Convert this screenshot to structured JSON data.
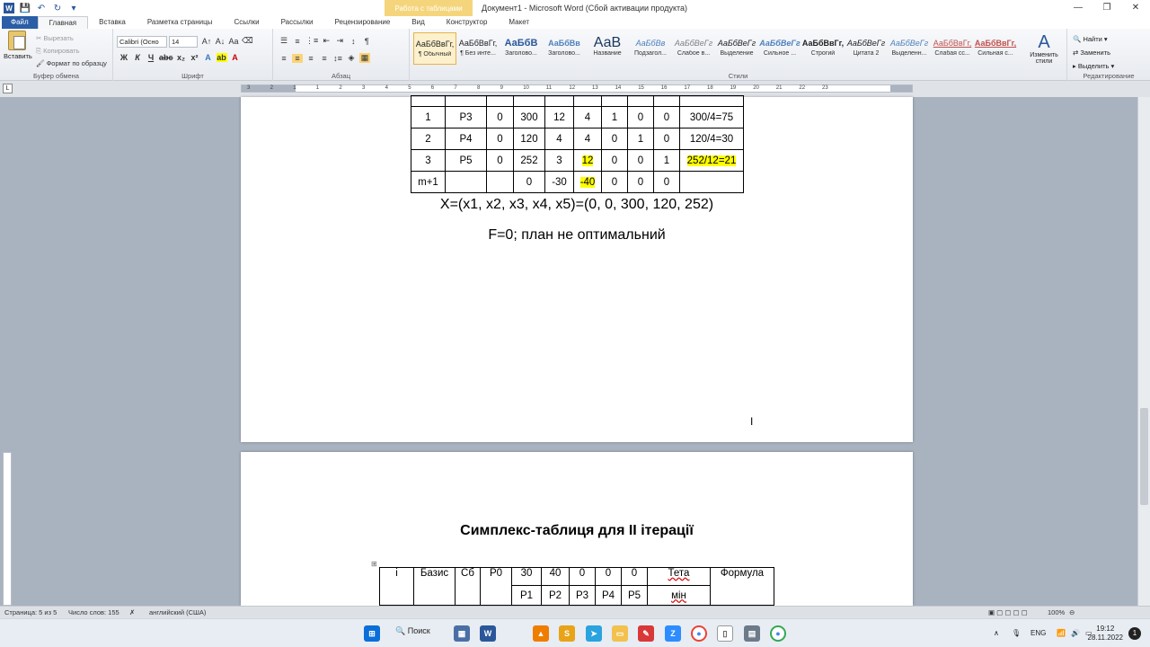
{
  "window": {
    "context_tab": "Работа с таблицами",
    "title": "Документ1 - Microsoft Word (Сбой активации продукта)",
    "minimize": "—",
    "maximize": "❐",
    "close": "✕"
  },
  "tabs": [
    "Файл",
    "Главная",
    "Вставка",
    "Разметка страницы",
    "Ссылки",
    "Рассылки",
    "Рецензирование",
    "Вид",
    "Конструктор",
    "Макет"
  ],
  "ribbon": {
    "clipboard": {
      "label": "Буфер обмена",
      "paste": "Вставить",
      "cut": "Вырезать",
      "copy": "Копировать",
      "format_painter": "Формат по образцу"
    },
    "font": {
      "label": "Шрифт",
      "font_name": "Calibri (Осно",
      "font_size": "14"
    },
    "paragraph": {
      "label": "Абзац"
    },
    "styles": {
      "label": "Стили",
      "items": [
        {
          "sample": "АаБбВвГг,",
          "name": "¶ Обычный"
        },
        {
          "sample": "АаБбВвГг,",
          "name": "¶ Без инте..."
        },
        {
          "sample": "АаБбВ",
          "name": "Заголово..."
        },
        {
          "sample": "АаБбВв",
          "name": "Заголово..."
        },
        {
          "sample": "АаВ",
          "name": "Название"
        },
        {
          "sample": "АаБбВв",
          "name": "Подзагол..."
        },
        {
          "sample": "АаБбВеГг",
          "name": "Слабое в..."
        },
        {
          "sample": "АаБбВеГг",
          "name": "Выделение"
        },
        {
          "sample": "АаБбВеГг",
          "name": "Сильное ..."
        },
        {
          "sample": "АаБбВвГг,",
          "name": "Строгий"
        },
        {
          "sample": "АаБбВеГг",
          "name": "Цитата 2"
        },
        {
          "sample": "АаБбВеГг",
          "name": "Выделенн..."
        },
        {
          "sample": "АаБбВвГг,",
          "name": "Слабая сс..."
        },
        {
          "sample": "АаБбВвГг,",
          "name": "Сильная с..."
        }
      ],
      "change_styles": "Изменить стили"
    },
    "editing": {
      "label": "Редактирование",
      "find": "Найти",
      "replace": "Заменить",
      "select": "Выделить"
    }
  },
  "ruler_numbers": [
    "3",
    "2",
    "1",
    "1",
    "2",
    "3",
    "4",
    "5",
    "6",
    "7",
    "8",
    "9",
    "10",
    "11",
    "12",
    "13",
    "14",
    "15",
    "16",
    "17",
    "18",
    "19",
    "20",
    "21",
    "22",
    "23"
  ],
  "page1": {
    "table_rows": [
      [
        "1",
        "P3",
        "0",
        "300",
        "12",
        "4",
        "1",
        "0",
        "0",
        "300/4=75"
      ],
      [
        "2",
        "P4",
        "0",
        "120",
        "4",
        "4",
        "0",
        "1",
        "0",
        "120/4=30"
      ],
      [
        "3",
        "P5",
        "0",
        "252",
        "3",
        "12",
        "0",
        "0",
        "1",
        "252/12=21"
      ],
      [
        "m+1",
        "",
        "",
        "0",
        "-30",
        "-40",
        "0",
        "0",
        "0",
        ""
      ]
    ],
    "plan_line": "X=(x1, x2, x3, x4, x5)=(0, 0, 300, 120, 252)",
    "f_line": "F=0; план не оптимальний"
  },
  "page2": {
    "heading": "Симплекс-таблиця  для ІІ ітерації",
    "header_row1": [
      "i",
      "Базис",
      "Сб",
      "P0",
      "30",
      "40",
      "0",
      "0",
      "0",
      "Тета",
      "Формула"
    ],
    "header_row2": [
      "P1",
      "P2",
      "P3",
      "P4",
      "P5",
      "мін"
    ]
  },
  "statusbar": {
    "page": "Страница: 5 из 5",
    "words": "Число слов: 155",
    "language": "английский (США)",
    "zoom": "100%"
  },
  "taskbar": {
    "search": "Поиск",
    "lang": "ENG",
    "time": "19:12",
    "date": "28.11.2022",
    "notifications": "1"
  }
}
